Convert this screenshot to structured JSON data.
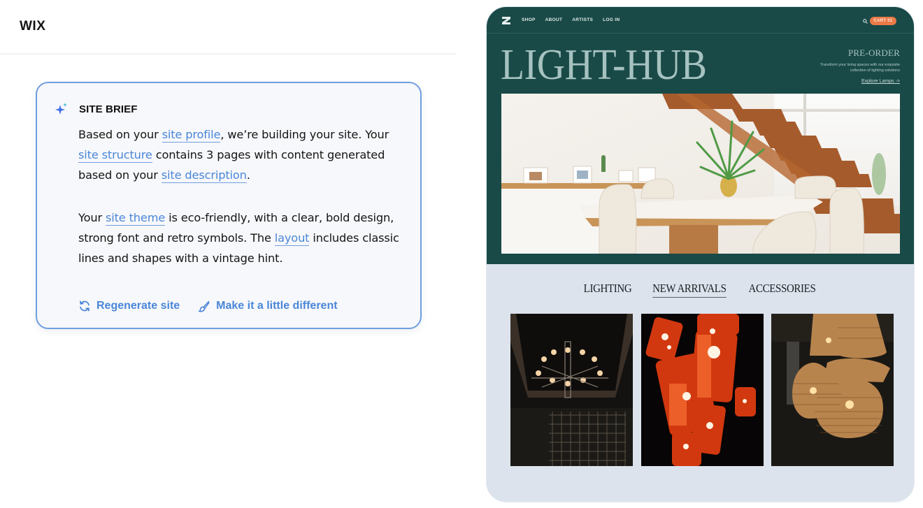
{
  "editor": {
    "logo": "WIX",
    "site_brief": {
      "title": "SITE BRIEF",
      "icon": "sparkle-icon",
      "paragraph1": {
        "t1": "Based on your ",
        "link1": "site profile",
        "t2": ", we’re building your site. Your ",
        "link2": "site structure",
        "t3": " contains 3 pages with content generated based on your ",
        "link3": "site description",
        "t4": "."
      },
      "paragraph2": {
        "t1": "Your ",
        "link1": "site theme",
        "t2": " is eco-friendly, with a clear, bold design, strong font and retro symbols. The ",
        "link2": "layout",
        "t3": " includes classic lines and shapes with a vintage hint."
      },
      "actions": [
        {
          "label": "Regenerate site",
          "icon": "refresh-icon"
        },
        {
          "label": "Make it a little different",
          "icon": "paintbrush-icon"
        }
      ]
    }
  },
  "preview": {
    "nav": {
      "logo": "Z",
      "items": [
        "SHOP",
        "ABOUT",
        "ARTISTS",
        "LOG IN"
      ],
      "search_icon": "search-icon",
      "cart_label": "CART 01"
    },
    "hero": {
      "brand": "LIGHT-HUB",
      "preorder_title": "PRE-ORDER",
      "preorder_desc": "Transform your living spaces with our exquisite collection of lighting solutions",
      "preorder_link": "Explore Lamps ->",
      "image_alt": "Bright dining room with wooden staircase and plant"
    },
    "categories": [
      {
        "label": "LIGHTING",
        "active": false
      },
      {
        "label": "NEW ARRIVALS",
        "active": true
      },
      {
        "label": "ACCESSORIES",
        "active": false
      }
    ],
    "products": [
      {
        "alt": "Black chandelier with candle bulbs"
      },
      {
        "alt": "Red cylindrical pendant lamps"
      },
      {
        "alt": "Woven rattan pendant lamps"
      }
    ]
  },
  "colors": {
    "accent_link": "#4a86d8",
    "card_border": "#6f9ee0",
    "hero_bg": "#194a47",
    "cart_bg": "#ea7a47",
    "preview_bg": "#dce3ed"
  }
}
